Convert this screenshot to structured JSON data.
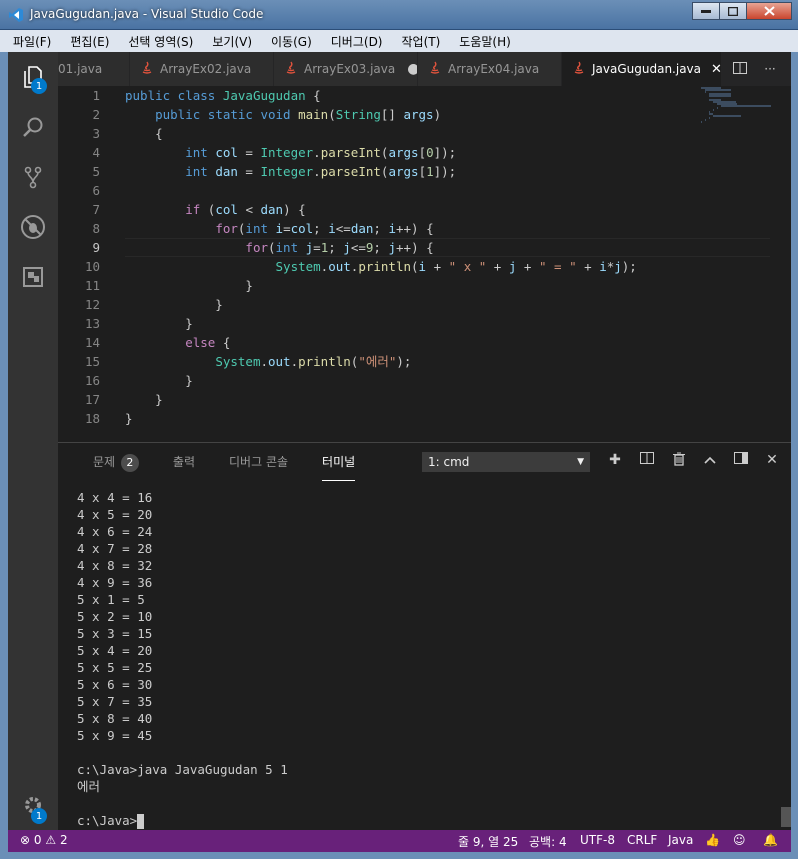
{
  "window": {
    "title": "JavaGugudan.java - Visual Studio Code"
  },
  "menu": [
    "파일(F)",
    "편집(E)",
    "선택 영역(S)",
    "보기(V)",
    "이동(G)",
    "디버그(D)",
    "작업(T)",
    "도움말(H)"
  ],
  "activity": {
    "explorer_badge": "1",
    "settings_badge": "1"
  },
  "tabs": [
    {
      "label": "01.java",
      "modified": false
    },
    {
      "label": "ArrayEx02.java",
      "modified": false
    },
    {
      "label": "ArrayEx03.java",
      "modified": true
    },
    {
      "label": "ArrayEx04.java",
      "modified": false
    },
    {
      "label": "JavaGugudan.java",
      "active": true
    }
  ],
  "editor": {
    "line_numbers": [
      "1",
      "2",
      "3",
      "4",
      "5",
      "6",
      "7",
      "8",
      "9",
      "10",
      "11",
      "12",
      "13",
      "14",
      "15",
      "16",
      "17",
      "18"
    ]
  },
  "panel": {
    "tabs": {
      "problems": "문제",
      "problems_count": "2",
      "output": "출력",
      "debug_console": "디버그 콘솔",
      "terminal": "터미널"
    },
    "terminal_select": "1: cmd"
  },
  "terminal_lines": [
    "4 x 4 = 16",
    "4 x 5 = 20",
    "4 x 6 = 24",
    "4 x 7 = 28",
    "4 x 8 = 32",
    "4 x 9 = 36",
    "5 x 1 = 5",
    "5 x 2 = 10",
    "5 x 3 = 15",
    "5 x 4 = 20",
    "5 x 5 = 25",
    "5 x 6 = 30",
    "5 x 7 = 35",
    "5 x 8 = 40",
    "5 x 9 = 45",
    "",
    "c:\\Java>java JavaGugudan 5 1",
    "에러",
    "",
    "c:\\Java>"
  ],
  "status": {
    "errors": "0",
    "warnings": "2",
    "position": "줄 9, 열 25",
    "spaces": "공백: 4",
    "encoding": "UTF-8",
    "eol": "CRLF",
    "language": "Java"
  },
  "colors": {
    "statusbar": "#68217a",
    "accent": "#007acc"
  }
}
